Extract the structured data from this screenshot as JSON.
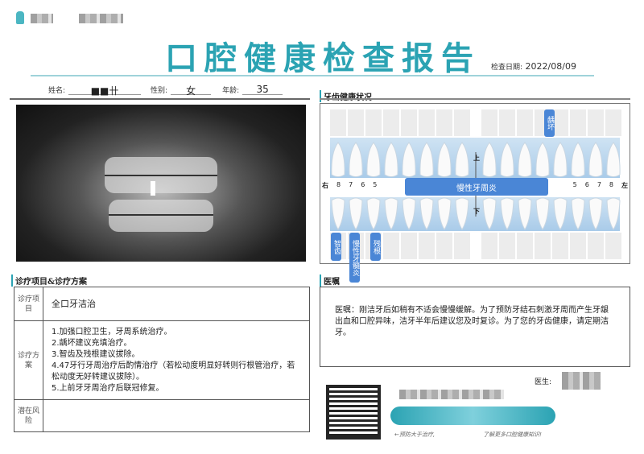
{
  "header": {
    "title": "口腔健康检查报告",
    "date_label": "检查日期:",
    "date": "2022/08/09"
  },
  "patient": {
    "name_label": "姓名:",
    "name": "■■卄",
    "gender_label": "性别:",
    "gender": "女",
    "age_label": "年龄:",
    "age": "35"
  },
  "sections": {
    "dental": "牙齿健康状况",
    "treatment": "诊疗项目&诊疗方案",
    "advice": "医嘱"
  },
  "chart": {
    "upper": "上",
    "lower": "下",
    "right": "右",
    "left": "左",
    "numbers_right": [
      "8",
      "7",
      "6",
      "5"
    ],
    "numbers_left": [
      "5",
      "6",
      "7",
      "8"
    ],
    "tags": {
      "caries": "龋坏",
      "periodontitis": "慢性牙周炎",
      "wisdom": "智齿",
      "pulpitis": "慢性牙髓炎",
      "residual_root": "残根"
    }
  },
  "treatment": {
    "item_label": "诊疗项目",
    "item": "全口牙洁治",
    "plan_label": "诊疗方案",
    "plan": [
      "1.加强口腔卫生，牙周系统治疗。",
      "2.龋坏建议充填治疗。",
      "3.智齿及残根建议拔除。",
      "4.47牙行牙周治疗后酌情治疗（若松动度明显好转则行根管治疗，若松动度无好转建议拔除）。",
      "5.上前牙牙周治疗后联冠修复。"
    ],
    "risk_label": "潜在风险",
    "risk": ""
  },
  "advice": {
    "text": "医嘱：刚洁牙后如稍有不适会慢慢缓解。为了预防牙结石刺激牙周而产生牙龈出血和口腔异味，洁牙半年后建议您及时复诊。为了您的牙齿健康，请定期洁牙。"
  },
  "footer": {
    "doctor_label": "医生:",
    "slogan_start": "←预防大于治疗,",
    "slogan_end": "了解更多口腔健康知识!"
  },
  "colors": {
    "accent": "#2ba3b3",
    "tag": "#4a86d6"
  }
}
